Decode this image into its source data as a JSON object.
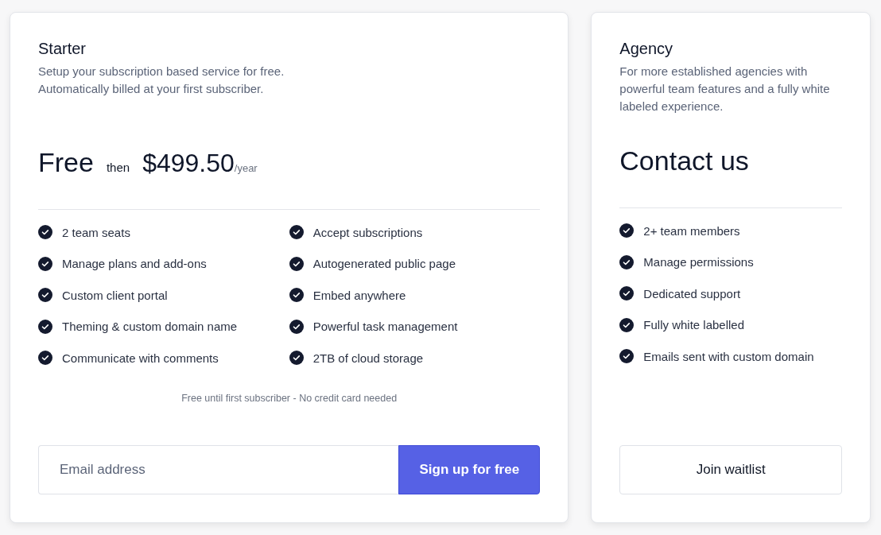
{
  "plans": [
    {
      "name": "Starter",
      "description_lines": [
        "Setup your subscription based service for free.",
        "Automatically billed at your first subscriber."
      ],
      "price": {
        "main": "Free",
        "connector": "then",
        "amount": "$499.50",
        "period": "/year"
      },
      "feature_columns": [
        [
          "2 team seats",
          "Manage plans and add-ons",
          "Custom client portal",
          "Theming & custom domain name",
          "Communicate with comments"
        ],
        [
          "Accept subscriptions",
          "Autogenerated public page",
          "Embed anywhere",
          "Powerful task management",
          "2TB of cloud storage"
        ]
      ],
      "note": "Free until first subscriber - No credit card needed",
      "form": {
        "kind": "signup",
        "placeholder": "Email address",
        "button": "Sign up for free"
      }
    },
    {
      "name": "Agency",
      "description_lines": [
        "For more established agencies with powerful team features and a fully white labeled experience."
      ],
      "price": {
        "main": "Contact us"
      },
      "feature_columns": [
        [
          "2+ team members",
          "Manage permissions",
          "Dedicated support",
          "Fully white labelled",
          "Emails sent with custom domain"
        ]
      ],
      "form": {
        "kind": "waitlist",
        "button": "Join waitlist"
      }
    }
  ]
}
